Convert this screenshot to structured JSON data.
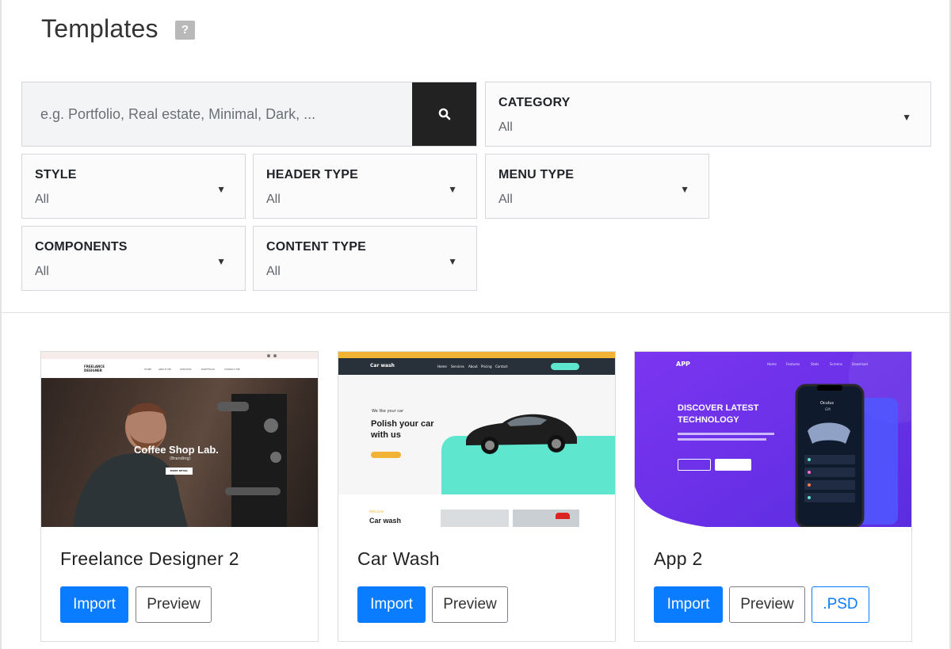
{
  "page": {
    "title": "Templates",
    "help_label": "?"
  },
  "search": {
    "placeholder": "e.g. Portfolio, Real estate, Minimal, Dark, ..."
  },
  "filters": {
    "category": {
      "label": "CATEGORY",
      "value": "All"
    },
    "style": {
      "label": "STYLE",
      "value": "All"
    },
    "header_type": {
      "label": "HEADER TYPE",
      "value": "All"
    },
    "menu_type": {
      "label": "MENU TYPE",
      "value": "All"
    },
    "components": {
      "label": "COMPONENTS",
      "value": "All"
    },
    "content_type": {
      "label": "CONTENT TYPE",
      "value": "All"
    }
  },
  "templates": [
    {
      "title": "Freelance Designer 2",
      "import_label": "Import",
      "preview_label": "Preview",
      "thumb": {
        "brand": "FREELANCE\nDESIGNER",
        "nav": [
          "HOME",
          "ABOUT ME",
          "SERVICES",
          "PORTFOLIO",
          "CONTACT ME"
        ],
        "headline": "Coffee Shop Lab.",
        "tag": "(Branding)",
        "cta": "MORE DETAIL"
      }
    },
    {
      "title": "Car Wash",
      "import_label": "Import",
      "preview_label": "Preview",
      "thumb": {
        "brand": "Car wash",
        "nav": [
          "Home",
          "Services",
          "About",
          "Pricing",
          "Contact"
        ],
        "kicker": "We like your car",
        "headline": "Polish your car with us",
        "section_kicker": "Welcome",
        "section_title": "Car wash"
      }
    },
    {
      "title": "App 2",
      "import_label": "Import",
      "preview_label": "Preview",
      "psd_label": ".PSD",
      "thumb": {
        "brand": "APP",
        "nav": [
          "Home",
          "Features",
          "Stats",
          "Screens",
          "Download"
        ],
        "headline": "DISCOVER LATEST TECHNOLOGY",
        "phone_title": "Oculus",
        "phone_sub": "Gift"
      }
    }
  ],
  "colors": {
    "accent": "#0a7cff",
    "search_button": "#222222",
    "car_wash_topbar": "#f2b233",
    "car_wash_teal": "#5ee6cf",
    "app_purple": "#7b35f0"
  }
}
